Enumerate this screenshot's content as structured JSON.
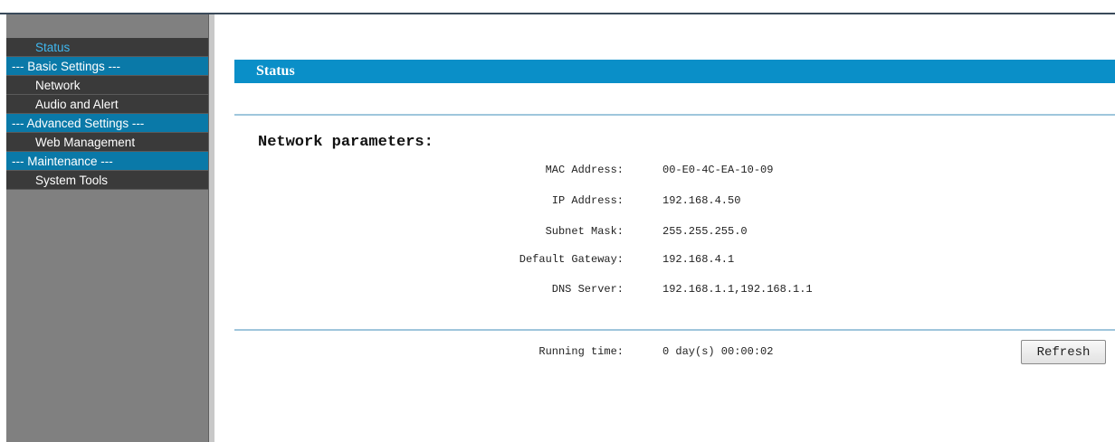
{
  "sidebar": {
    "items": [
      {
        "label": "Status"
      },
      {
        "label": "--- Basic Settings ---"
      },
      {
        "label": "Network"
      },
      {
        "label": "Audio and Alert"
      },
      {
        "label": "--- Advanced Settings ---"
      },
      {
        "label": "Web Management"
      },
      {
        "label": "--- Maintenance ---"
      },
      {
        "label": "System Tools"
      }
    ]
  },
  "main": {
    "title": "Status",
    "section_heading": "Network parameters:",
    "params": [
      {
        "label": "MAC Address:",
        "value": "00-E0-4C-EA-10-09"
      },
      {
        "label": "IP Address:",
        "value": "192.168.4.50"
      },
      {
        "label": "Subnet Mask:",
        "value": "255.255.255.0"
      },
      {
        "label": "Default Gateway:",
        "value": "192.168.4.1"
      },
      {
        "label": "DNS Server:",
        "value": "192.168.1.1,192.168.1.1"
      }
    ],
    "running_time": {
      "label": "Running time:",
      "value": "0 day(s) 00:00:02"
    },
    "refresh_label": "Refresh"
  },
  "colors": {
    "sidebar_bg": "#808080",
    "menu_link_bg": "#3a3a3a",
    "menu_section_bg": "#0a79a8",
    "active_text": "#3fb8f0",
    "title_bar": "#0a8fc8"
  }
}
